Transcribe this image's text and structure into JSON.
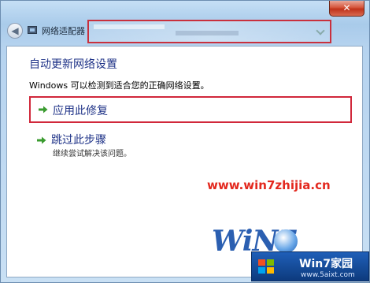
{
  "window": {
    "close_label": "✕"
  },
  "navbar": {
    "title": "网络适配器"
  },
  "content": {
    "heading": "自动更新网络设置",
    "description": "Windows 可以检测到适合您的正确网络设置。",
    "options": [
      {
        "label": "应用此修复",
        "sublabel": ""
      },
      {
        "label": "跳过此步骤",
        "sublabel": "继续尝试解决该问题。"
      }
    ]
  },
  "watermark": {
    "url": "www.win7zhijia.cn",
    "logo_text": "WiN7",
    "badge_title": "Win7家园",
    "badge_url": "www.5aixt.com"
  },
  "colors": {
    "accent": "#1e3287",
    "highlight_border": "#d1283b",
    "arrow": "#3a9b2f"
  }
}
